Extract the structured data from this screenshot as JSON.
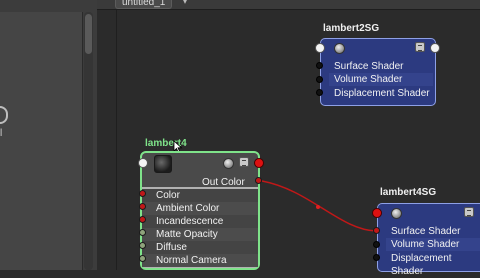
{
  "tab": {
    "label": "untitled_1",
    "close_glyph": "▾"
  },
  "left_panel": {
    "glyph_text": "l"
  },
  "nodes": {
    "lambert2SG": {
      "title": "lambert2SG",
      "rows": [
        "Surface Shader",
        "Volume Shader",
        "Displacement Shader"
      ]
    },
    "lambert4": {
      "title": "lambert4",
      "output": "Out Color",
      "rows": [
        "Color",
        "Ambient Color",
        "Incandescence",
        "Matte Opacity",
        "Diffuse",
        "Normal Camera"
      ]
    },
    "lambert4SG": {
      "title": "lambert4SG",
      "rows": [
        "Surface Shader",
        "Volume Shader",
        "Displacement Shader"
      ]
    }
  },
  "colors": {
    "canvas": "#2b2b2b",
    "sg_node": "#2c3a80",
    "shader_node": "#b7b7b7",
    "selected_title": "#7fe38a",
    "connection": "#c01818"
  }
}
